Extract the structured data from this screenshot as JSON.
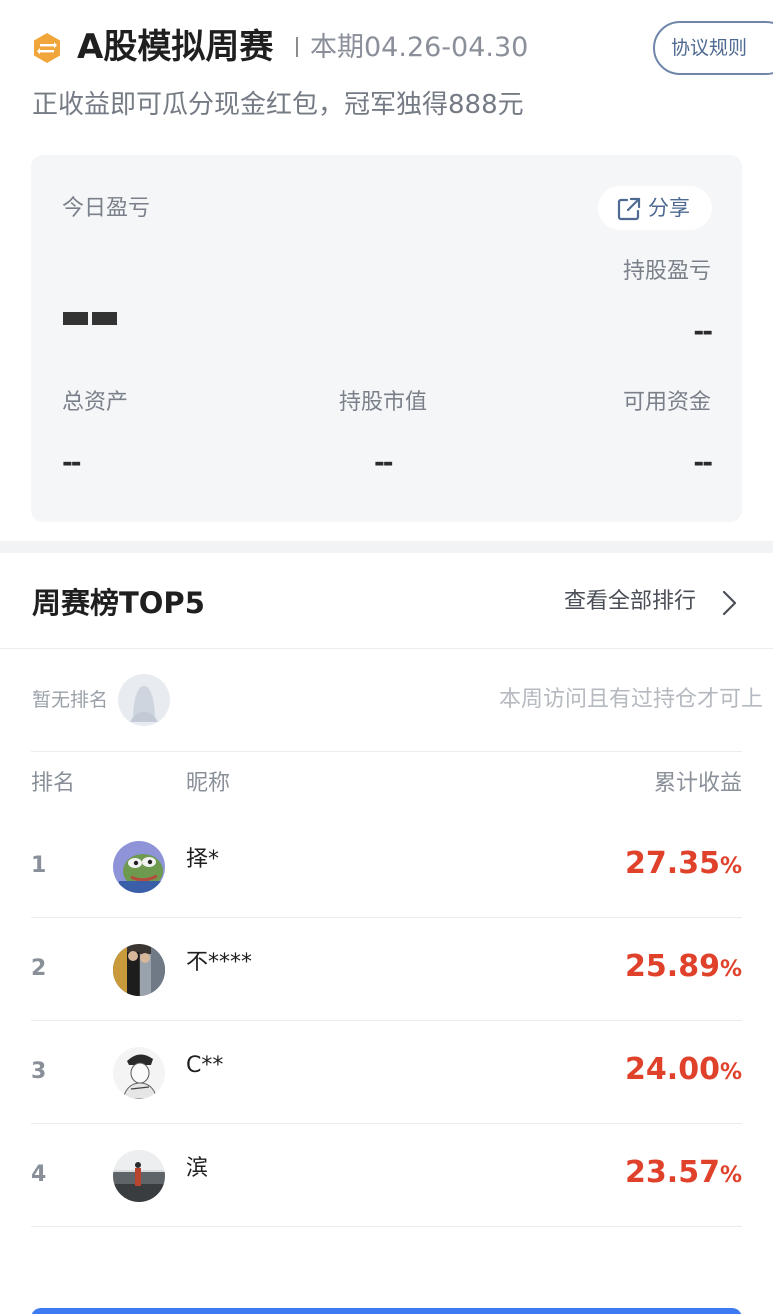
{
  "header": {
    "title": "A股模拟周赛",
    "period": "本期04.26-04.30",
    "rules_button": "协议规则",
    "subtitle": "正收益即可瓜分现金红包，冠军独得888元",
    "logo_icon": "exchange-hexagon-icon",
    "accent_color": "#f0a63a"
  },
  "account": {
    "today_pl_label": "今日盈亏",
    "share_label": "分享",
    "share_icon": "share-external-icon",
    "holding_pl_label": "持股盈亏",
    "holding_pl_value": "--",
    "total_assets_label": "总资产",
    "total_assets_value": "--",
    "market_value_label": "持股市值",
    "market_value_value": "--",
    "available_funds_label": "可用资金",
    "available_funds_value": "--"
  },
  "leaderboard": {
    "title": "周赛榜TOP5",
    "view_all": "查看全部排行",
    "no_rank_label": "暂无排名",
    "no_rank_hint": "本周访问且有过持仓才可上",
    "columns": {
      "rank": "排名",
      "nickname": "昵称",
      "yield": "累计收益"
    },
    "rows": [
      {
        "rank": "1",
        "nickname": "择*",
        "yield": "27.35",
        "unit": "%"
      },
      {
        "rank": "2",
        "nickname": "不****",
        "yield": "25.89",
        "unit": "%"
      },
      {
        "rank": "3",
        "nickname": "C**",
        "yield": "24.00",
        "unit": "%"
      },
      {
        "rank": "4",
        "nickname": "滨",
        "yield": "23.57",
        "unit": "%"
      }
    ],
    "positive_color": "#e0412b"
  }
}
